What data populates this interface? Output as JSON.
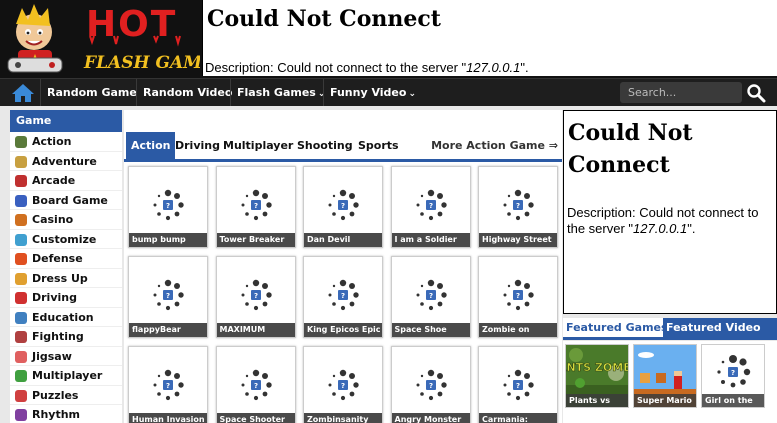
{
  "header": {
    "logo_alt": "HOT FLASH GAME",
    "error_title": "Could Not Connect",
    "error_desc_prefix": "Description: Could not connect to the server \"",
    "error_desc_server": "127.0.0.1",
    "error_desc_suffix": "\"."
  },
  "nav": {
    "home_icon": "home-icon",
    "items": [
      {
        "label": "Random Game"
      },
      {
        "label": "Random Video"
      },
      {
        "label": "Flash Games",
        "chevron": "⌄"
      },
      {
        "label": "Funny Video",
        "chevron": "⌄"
      }
    ],
    "search_placeholder": "Search...",
    "search_icon": "search-icon"
  },
  "sidebar": {
    "title": "Game Categories",
    "categories": [
      {
        "label": "Action",
        "icon": "action-icon",
        "color": "#5a7a3a"
      },
      {
        "label": "Adventure",
        "icon": "adventure-icon",
        "color": "#c8a040"
      },
      {
        "label": "Arcade",
        "icon": "arcade-icon",
        "color": "#c03030"
      },
      {
        "label": "Board Game",
        "icon": "board-game-icon",
        "color": "#3a60c0"
      },
      {
        "label": "Casino",
        "icon": "casino-icon",
        "color": "#d07020"
      },
      {
        "label": "Customize",
        "icon": "customize-icon",
        "color": "#40a0d0"
      },
      {
        "label": "Defense",
        "icon": "defense-icon",
        "color": "#e05020"
      },
      {
        "label": "Dress Up",
        "icon": "dress-up-icon",
        "color": "#e0a030"
      },
      {
        "label": "Driving",
        "icon": "driving-icon",
        "color": "#d03030"
      },
      {
        "label": "Education",
        "icon": "education-icon",
        "color": "#4080c0"
      },
      {
        "label": "Fighting",
        "icon": "fighting-icon",
        "color": "#b04040"
      },
      {
        "label": "Jigsaw",
        "icon": "jigsaw-icon",
        "color": "#e06060"
      },
      {
        "label": "Multiplayer",
        "icon": "multiplayer-icon",
        "color": "#40a040"
      },
      {
        "label": "Puzzles",
        "icon": "puzzles-icon",
        "color": "#d04040"
      },
      {
        "label": "Rhythm",
        "icon": "rhythm-icon",
        "color": "#8040a0"
      }
    ]
  },
  "tabs": {
    "items": [
      "Action",
      "Driving",
      "Multiplayer",
      "Shooting",
      "Sports"
    ],
    "active": "Action",
    "more": "More Action Game ⇒"
  },
  "games": [
    "bump bump",
    "Tower Breaker",
    "Dan Devil",
    "I am a Soldier",
    "Highway Street",
    "flappyBear",
    "MAXIMUM",
    "King Epicos Epic",
    "Space Shoe",
    "Zombie on",
    "Human Invasion",
    "Space Shooter",
    "Zombinsanity",
    "Angry Monster",
    "Carmania:"
  ],
  "right_error": {
    "title": "Could Not Connect",
    "desc_prefix": "Description: Could not connect to the server \"",
    "desc_server": "127.0.0.1",
    "desc_suffix": "\"."
  },
  "featured": {
    "tab_games": "Featured Games",
    "tab_video": "Featured Video",
    "items": [
      {
        "label": "Plants vs",
        "title_art": "PLANTS ZOMBIES"
      },
      {
        "label": "Super Mario"
      },
      {
        "label": "Girl on the"
      }
    ]
  },
  "colors": {
    "accent": "#2b5aa5",
    "header_bg": "#111111",
    "logo_red": "#e02020"
  }
}
